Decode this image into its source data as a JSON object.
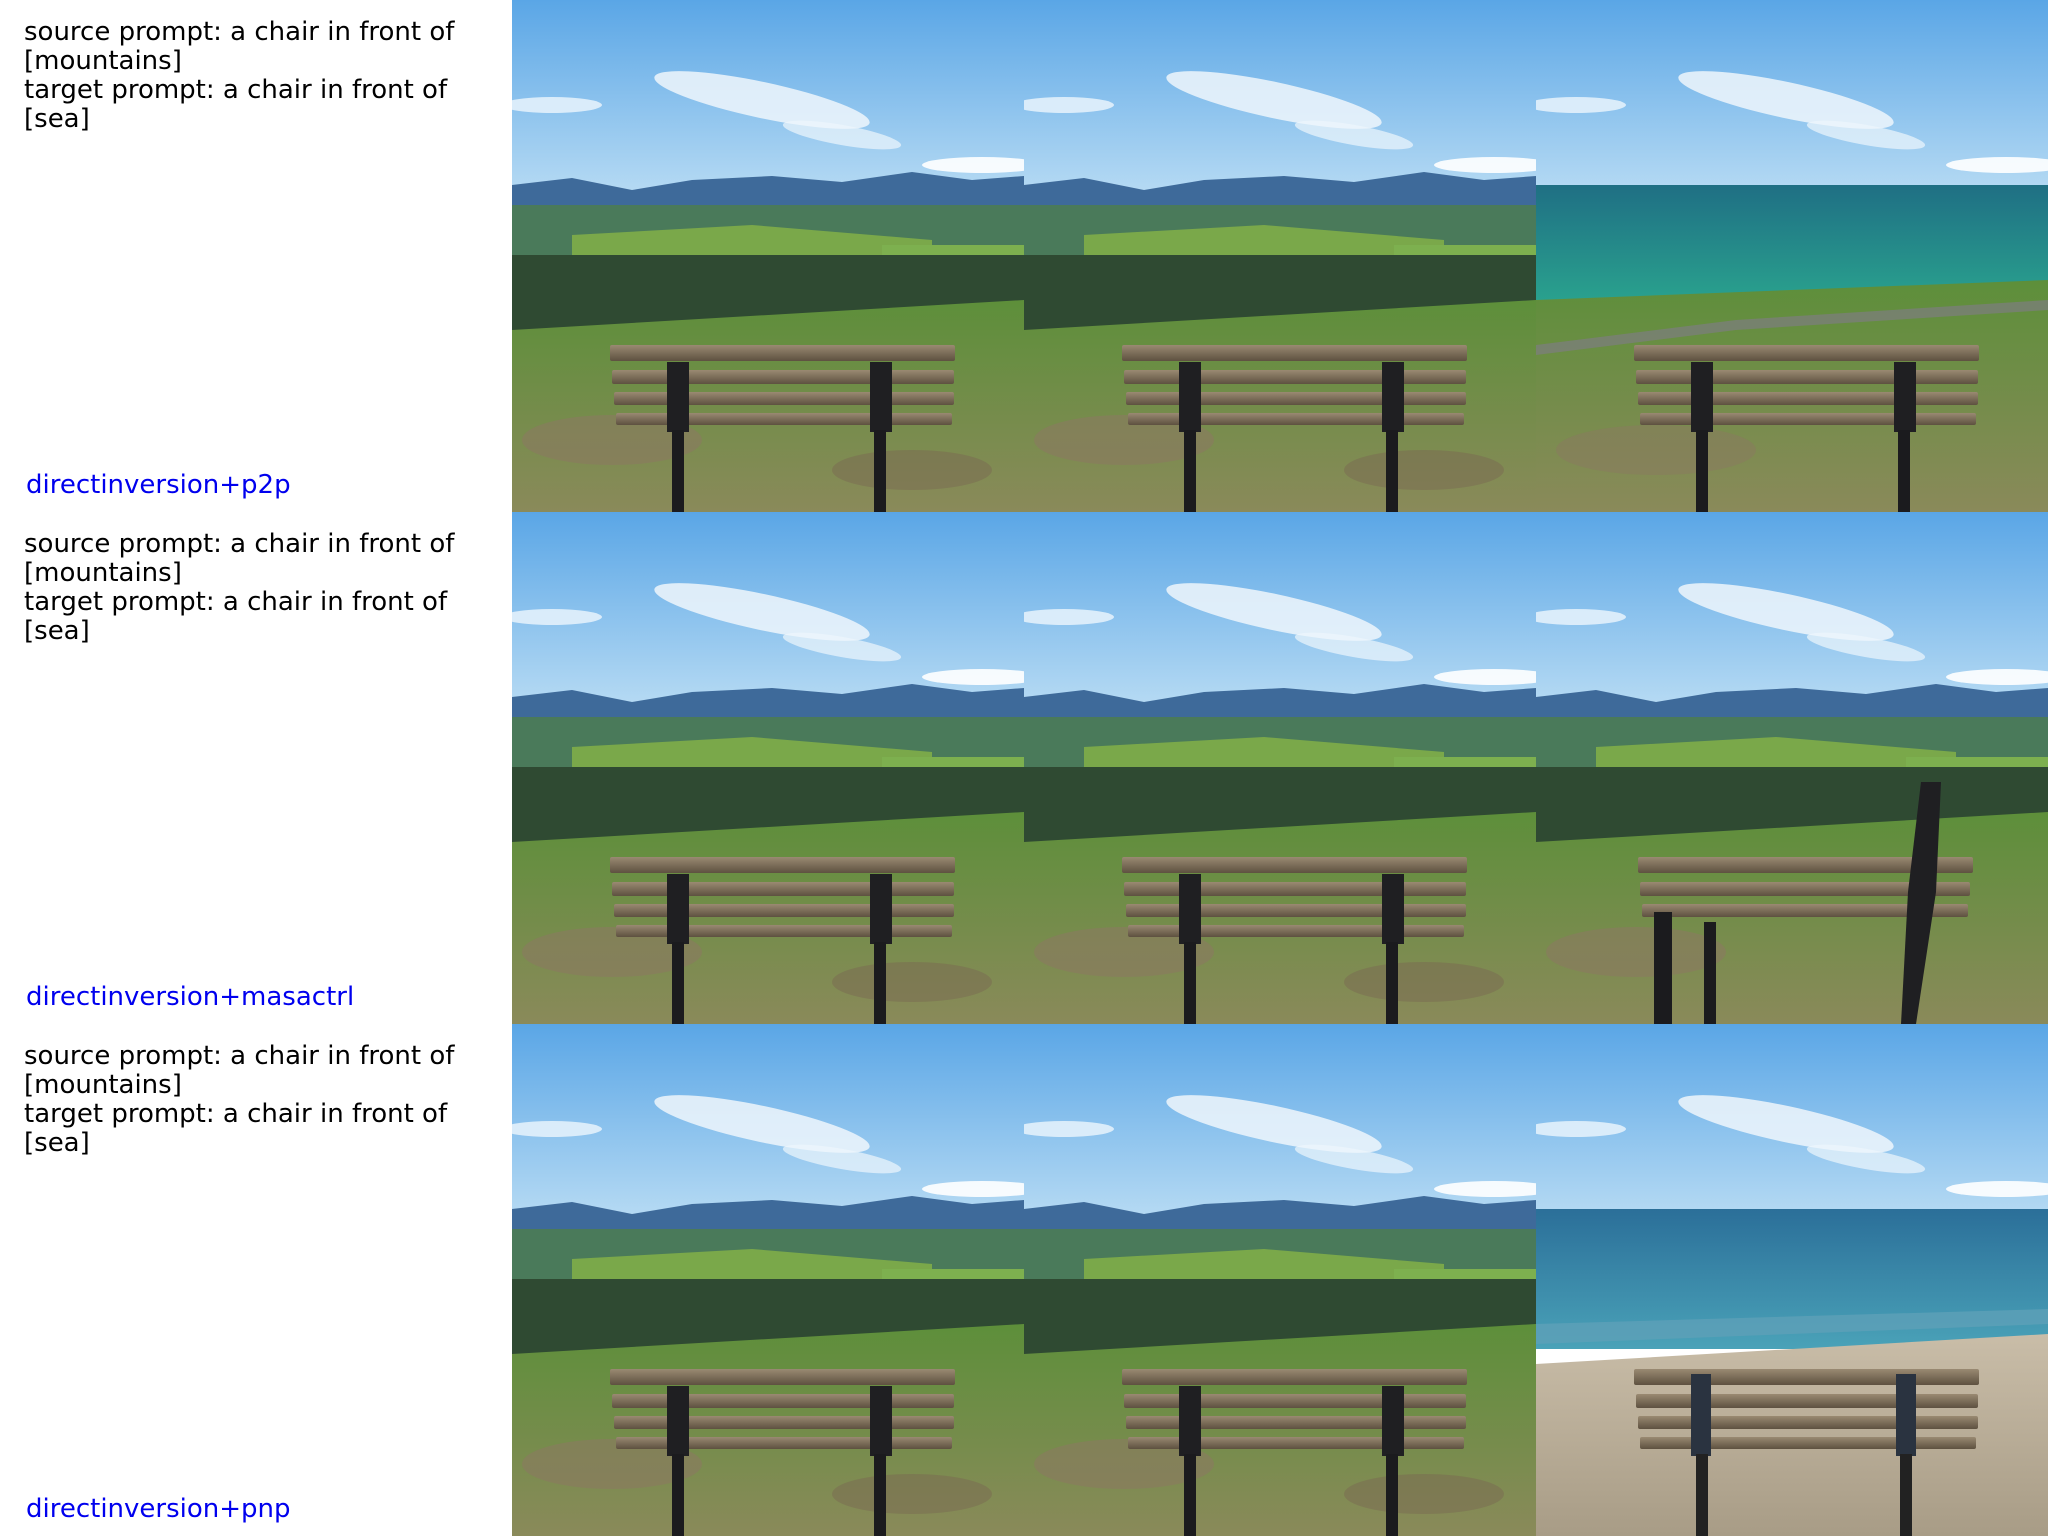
{
  "colors": {
    "method_label": "#0000ee",
    "prompt_text": "#000000",
    "background": "#ffffff"
  },
  "rows": [
    {
      "prompt_text": "source prompt: a chair in front of\n[mountains]\ntarget prompt: a chair in front of [sea]",
      "method": "directinversion+p2p",
      "panels": [
        "mountain-landscape-bench",
        "mountain-landscape-bench",
        "sea-with-grass-bench"
      ]
    },
    {
      "prompt_text": "source prompt: a chair in front of\n[mountains]\ntarget prompt: a chair in front of [sea]",
      "method": "directinversion+masactrl",
      "panels": [
        "mountain-landscape-bench",
        "mountain-landscape-bench",
        "mountain-landscape-distorted-bench"
      ]
    },
    {
      "prompt_text": "source prompt: a chair in front of\n[mountains]\ntarget prompt: a chair in front of [sea]",
      "method": "directinversion+pnp",
      "panels": [
        "mountain-landscape-bench",
        "mountain-landscape-bench",
        "sea-with-sand-bench"
      ]
    }
  ]
}
